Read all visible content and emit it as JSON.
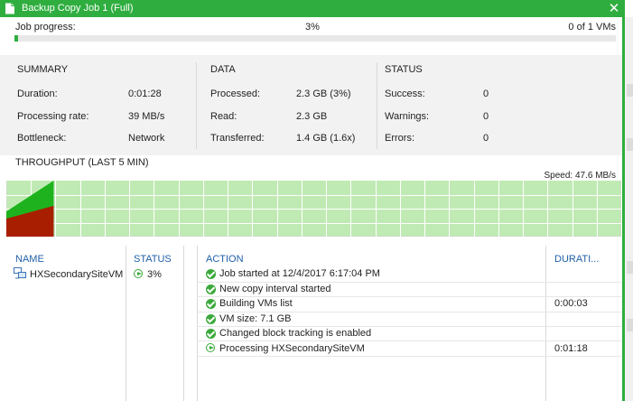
{
  "window": {
    "title": "Backup Copy Job 1 (Full)",
    "close_glyph": "✕",
    "accent_color": "#2fae3f"
  },
  "progress": {
    "label": "Job progress:",
    "percent_text": "3%",
    "percent": 3,
    "count_text": "0 of 1 VMs"
  },
  "summary": {
    "title": "SUMMARY",
    "items": [
      {
        "label": "Duration:",
        "value": "0:01:28"
      },
      {
        "label": "Processing rate:",
        "value": "39 MB/s"
      },
      {
        "label": "Bottleneck:",
        "value": "Network"
      }
    ]
  },
  "data_section": {
    "title": "DATA",
    "items": [
      {
        "label": "Processed:",
        "value": "2.3 GB (3%)"
      },
      {
        "label": "Read:",
        "value": "2.3 GB"
      },
      {
        "label": "Transferred:",
        "value": "1.4 GB (1.6x)"
      }
    ]
  },
  "status_section": {
    "title": "STATUS",
    "items": [
      {
        "label": "Success:",
        "value": "0"
      },
      {
        "label": "Warnings:",
        "value": "0"
      },
      {
        "label": "Errors:",
        "value": "0"
      }
    ]
  },
  "throughput": {
    "title": "THROUGHPUT (LAST 5 MIN)",
    "speed_text": "Speed: 47.6 MB/s"
  },
  "chart_data": {
    "type": "area",
    "title": "THROUGHPUT (LAST 5 MIN)",
    "annotation": "Speed: 47.6 MB/s",
    "series": [
      {
        "color": "#1eb31e",
        "points": [
          [
            0,
            0.45
          ],
          [
            0.077,
            1.0
          ]
        ]
      },
      {
        "color": "#a81e00",
        "points": [
          [
            0,
            0.32
          ],
          [
            0.077,
            0.55
          ]
        ]
      }
    ],
    "background_color": "#c0eab4",
    "grid": true,
    "grid_columns": 25,
    "grid_rows": 4
  },
  "table": {
    "vm_headers": {
      "name": "NAME",
      "status": "STATUS"
    },
    "vm_rows": [
      {
        "name": "HXSecondarySiteVM",
        "status": "3%"
      }
    ],
    "action_headers": {
      "action": "ACTION",
      "duration": "DURATI..."
    },
    "actions": [
      {
        "icon": "check-icon",
        "text": "Job started at 12/4/2017 6:17:04 PM",
        "duration": ""
      },
      {
        "icon": "check-icon",
        "text": "New copy interval started",
        "duration": ""
      },
      {
        "icon": "check-icon",
        "text": "Building VMs list",
        "duration": "0:00:03"
      },
      {
        "icon": "check-icon",
        "text": "VM size: 7.1 GB",
        "duration": ""
      },
      {
        "icon": "check-icon",
        "text": "Changed block tracking is enabled",
        "duration": ""
      },
      {
        "icon": "running-icon",
        "text": "Processing HXSecondarySiteVM",
        "duration": "0:01:18"
      }
    ]
  }
}
